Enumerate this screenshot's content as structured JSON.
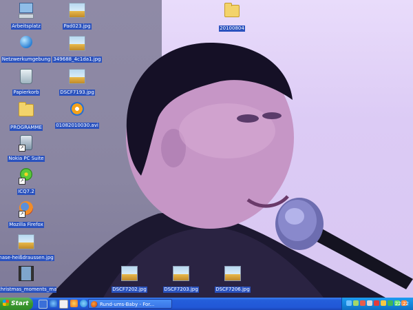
{
  "desktop": {
    "icons": [
      {
        "label": "Arbeitsplatz",
        "icon": "my-computer-icon"
      },
      {
        "label": "Netzwerkumgebung",
        "icon": "network-icon"
      },
      {
        "label": "Papierkorb",
        "icon": "recycle-bin-icon"
      },
      {
        "label": "PROGRAMME",
        "icon": "folder-icon"
      },
      {
        "label": "Nokia PC Suite",
        "icon": "nokia-pc-suite-icon"
      },
      {
        "label": "ICQ7.2",
        "icon": "icq-flower-icon"
      },
      {
        "label": "Mozilla Firefox",
        "icon": "firefox-icon"
      },
      {
        "label": "nase-heißdraussen.jpg",
        "icon": "image-file-icon"
      },
      {
        "label": "christmas_moments_makin...",
        "icon": "video-file-icon"
      },
      {
        "label": "Pad023.jpg",
        "icon": "image-file-icon"
      },
      {
        "label": "349688_4c1da1.jpg",
        "icon": "image-file-icon"
      },
      {
        "label": "DSCF7193.jpg",
        "icon": "image-file-icon"
      },
      {
        "label": "01082010030.avi",
        "icon": "media-file-icon"
      },
      {
        "label": "20100804",
        "icon": "folder-icon"
      },
      {
        "label": "DSCF7202.jpg",
        "icon": "image-file-icon"
      },
      {
        "label": "DSCF7203.jpg",
        "icon": "image-file-icon"
      },
      {
        "label": "DSCF7206.jpg",
        "icon": "image-file-icon"
      }
    ]
  },
  "taskbar": {
    "start_label": "Start",
    "quicklaunch": [
      "show-desktop-icon",
      "internet-explorer-icon",
      "email-icon",
      "media-player-icon",
      "skype-icon",
      "firefox-icon"
    ],
    "window_title": "Rund-ums-Baby - For...",
    "tray_icons": [
      "bluetooth-icon",
      "network-icon",
      "security-icon",
      "volume-icon",
      "antivirus-icon",
      "update-icon",
      "shield-icon",
      "messenger-icon",
      "chat-icon"
    ],
    "clock": "22:22"
  }
}
